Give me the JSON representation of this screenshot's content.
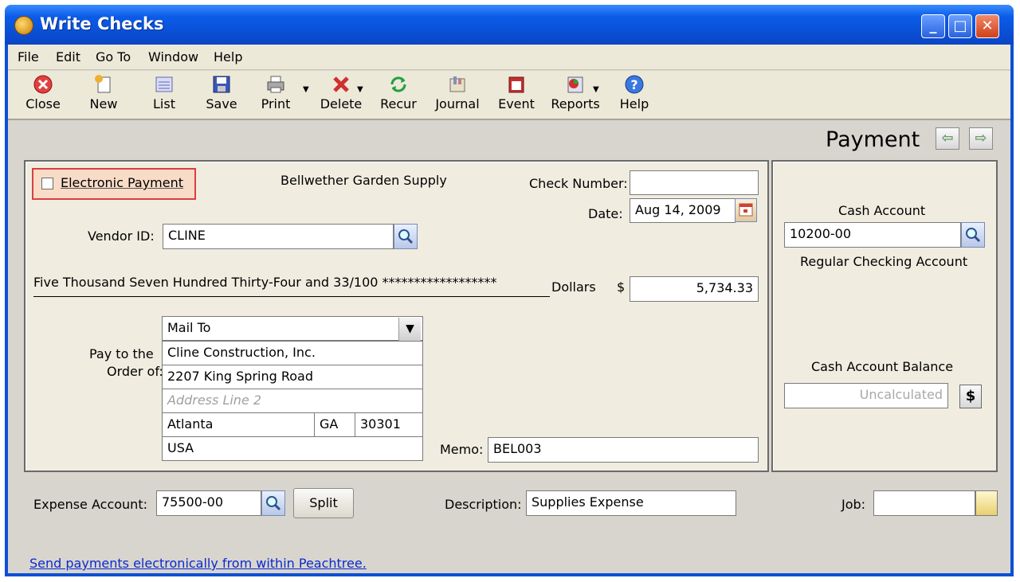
{
  "window": {
    "title": "Write Checks",
    "controls": {
      "minimize": "_",
      "maximize": "□",
      "close": "✕"
    }
  },
  "menu": [
    "File",
    "Edit",
    "Go To",
    "Window",
    "Help"
  ],
  "toolbar": {
    "close": "Close",
    "new": "New",
    "list": "List",
    "save": "Save",
    "print": "Print",
    "delete": "Delete",
    "recur": "Recur",
    "journal": "Journal",
    "event": "Event",
    "reports": "Reports",
    "help": "Help"
  },
  "header": {
    "title": "Payment",
    "prev": "⇦",
    "next": "⇨"
  },
  "check": {
    "electronic_payment_label": "Electronic Payment",
    "electronic_payment_checked": false,
    "company_name": "Bellwether Garden Supply",
    "check_number_label": "Check Number:",
    "check_number_value": "",
    "date_label": "Date:",
    "date_value": "Aug 14, 2009",
    "vendor_id_label": "Vendor ID:",
    "vendor_id_value": "CLINE",
    "written_amount": "Five Thousand Seven Hundred Thirty-Four and 33/100  ******************",
    "dollars_label": "Dollars",
    "dollar_sign": "$",
    "amount_value": "5,734.33",
    "pay_to_label_line1": "Pay to the",
    "pay_to_label_line2": "Order of:",
    "address_type": "Mail To",
    "payee_name": "Cline Construction, Inc.",
    "address_line1": "2207 King Spring Road",
    "address_line2_placeholder": "Address Line 2",
    "city": "Atlanta",
    "state": "GA",
    "zip": "30301",
    "country": "USA",
    "memo_label": "Memo:",
    "memo_value": "BEL003"
  },
  "cash": {
    "account_label": "Cash Account",
    "account_value": "10200-00",
    "account_name": "Regular Checking Account",
    "balance_label": "Cash Account Balance",
    "balance_value": "Uncalculated",
    "balance_button": "$"
  },
  "footer": {
    "expense_account_label": "Expense Account:",
    "expense_account_value": "75500-00",
    "split_label": "Split",
    "description_label": "Description:",
    "description_value": "Supplies Expense",
    "job_label": "Job:",
    "job_value": "",
    "link_text": "Send payments electronically from within Peachtree."
  },
  "colors": {
    "titlebar": "#0a4fd6",
    "panel": "#f0ece0",
    "client": "#d8d5ce",
    "highlight_border": "#d84040",
    "link": "#0a2ad0"
  }
}
